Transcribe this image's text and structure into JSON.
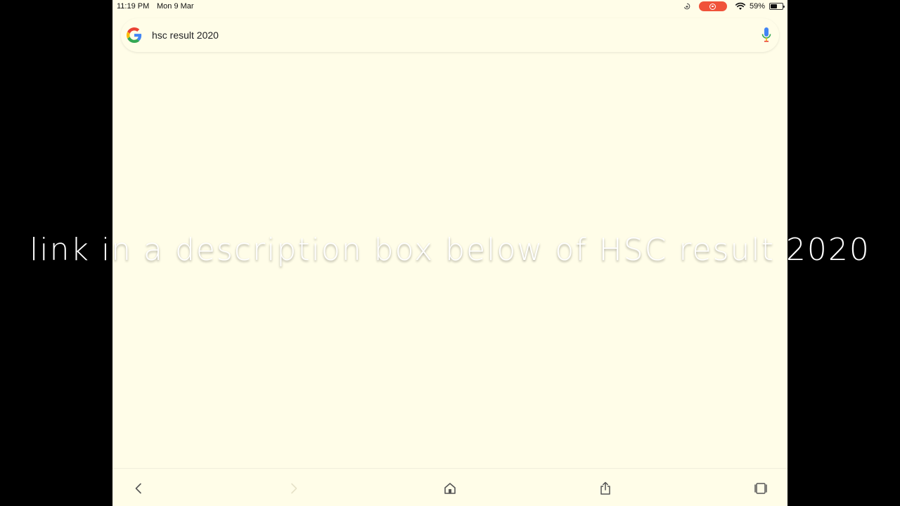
{
  "status_bar": {
    "time": "11:19 PM",
    "date": "Mon 9 Mar",
    "battery_percent": "59%",
    "battery_level": 0.59,
    "recording_color": "#f0533a"
  },
  "search": {
    "query": "hsc result 2020"
  },
  "caption": {
    "text": "link in a description box below of HSC result 2020"
  },
  "toolbar": {
    "icons": [
      "back-icon",
      "forward-icon",
      "home-icon",
      "share-icon",
      "tabs-icon"
    ]
  },
  "colors": {
    "page_background": "#fffde8",
    "letterbox": "#000000",
    "icon": "#555555"
  }
}
